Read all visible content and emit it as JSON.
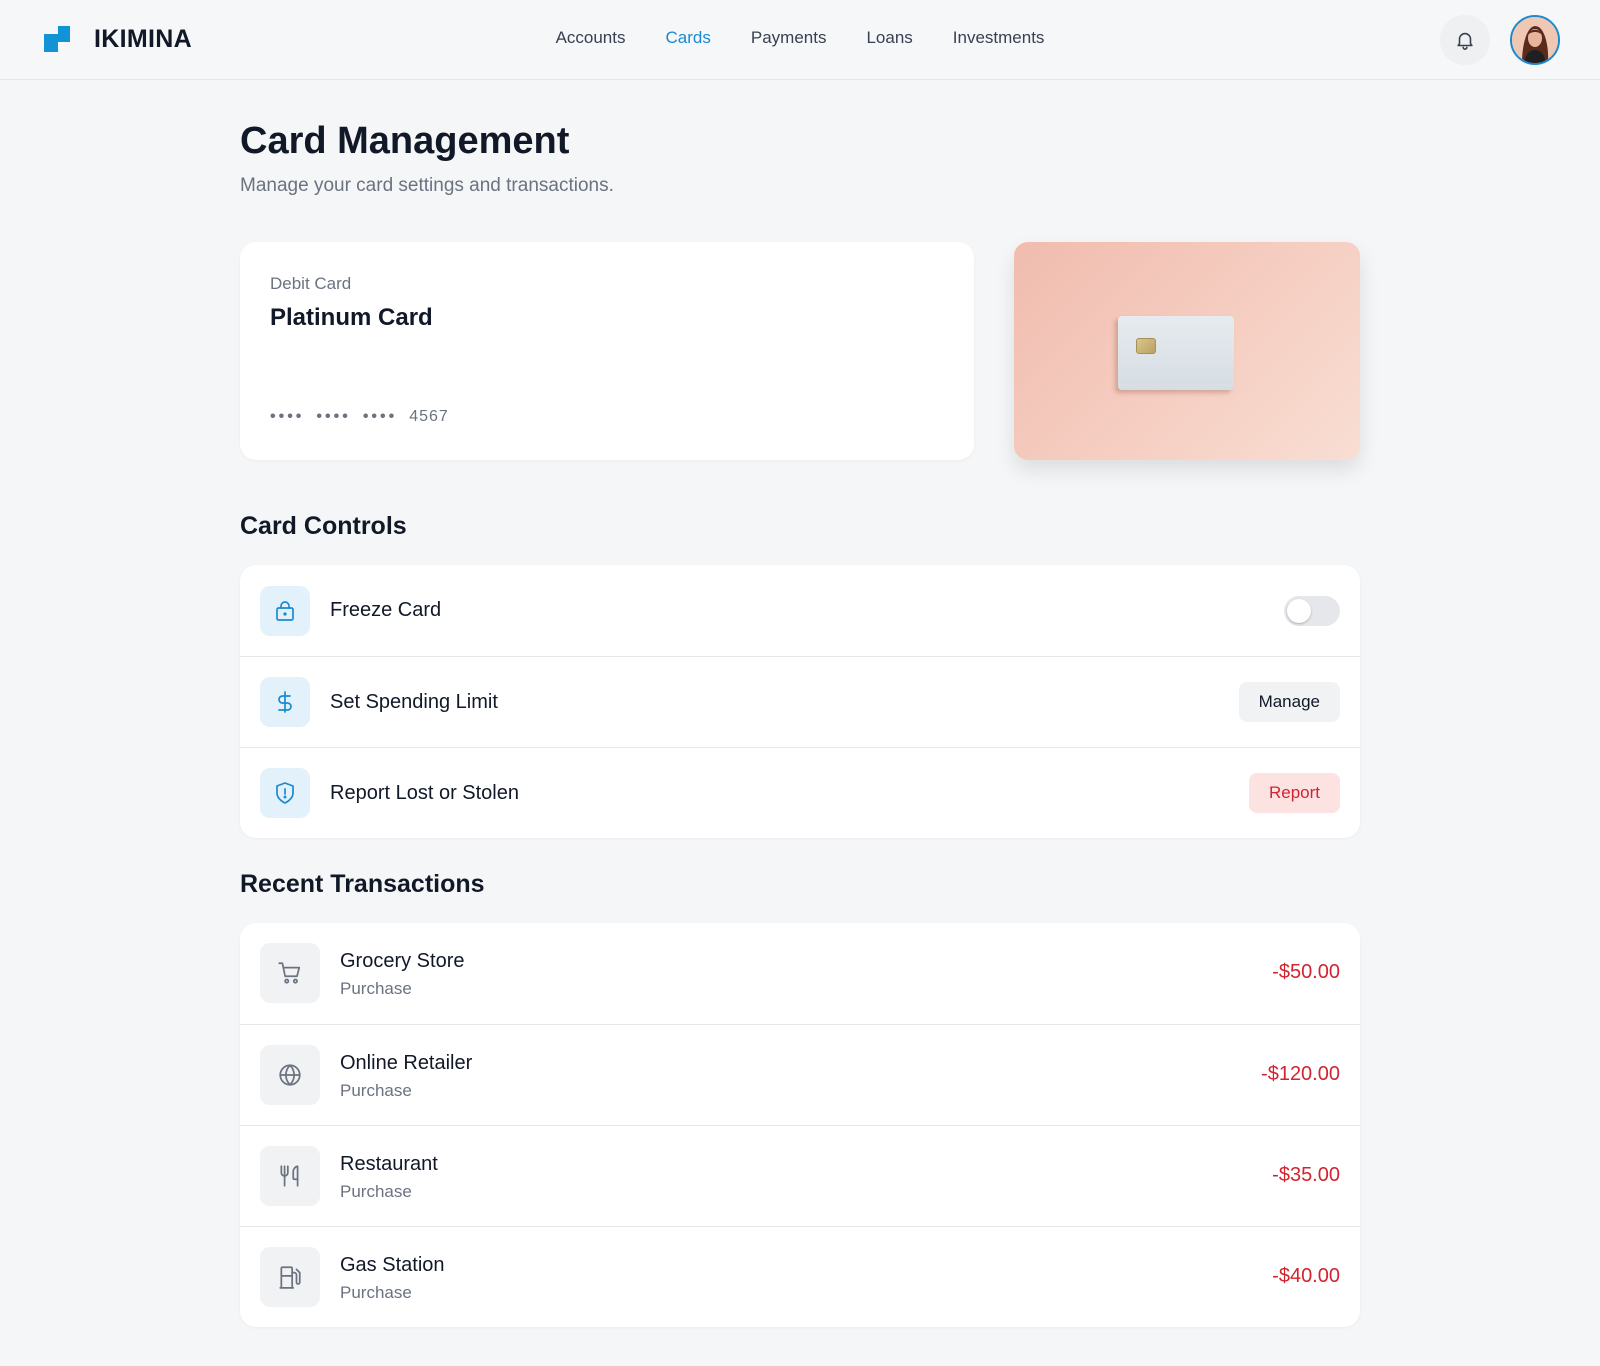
{
  "header": {
    "brand": "IKIMINA",
    "nav": [
      {
        "label": "Accounts",
        "active": false
      },
      {
        "label": "Cards",
        "active": true
      },
      {
        "label": "Payments",
        "active": false
      },
      {
        "label": "Loans",
        "active": false
      },
      {
        "label": "Investments",
        "active": false
      }
    ],
    "notification_icon": "bell-icon",
    "avatar_icon": "user-avatar"
  },
  "page": {
    "title": "Card Management",
    "subtitle": "Manage your card settings and transactions."
  },
  "card": {
    "type": "Debit Card",
    "name": "Platinum Card",
    "masked_groups": [
      "••••",
      "••••",
      "••••"
    ],
    "last4": "4567"
  },
  "controls": {
    "title": "Card Controls",
    "items": [
      {
        "label": "Freeze Card",
        "icon": "lock-icon",
        "action": "toggle",
        "toggle_on": false
      },
      {
        "label": "Set Spending Limit",
        "icon": "dollar-icon",
        "action": "Manage"
      },
      {
        "label": "Report Lost or Stolen",
        "icon": "shield-alert-icon",
        "action": "Report"
      }
    ]
  },
  "transactions": {
    "title": "Recent Transactions",
    "items": [
      {
        "name": "Grocery Store",
        "type": "Purchase",
        "amount": "-$50.00",
        "icon": "cart-icon"
      },
      {
        "name": "Online Retailer",
        "type": "Purchase",
        "amount": "-$120.00",
        "icon": "globe-icon"
      },
      {
        "name": "Restaurant",
        "type": "Purchase",
        "amount": "-$35.00",
        "icon": "utensils-icon"
      },
      {
        "name": "Gas Station",
        "type": "Purchase",
        "amount": "-$40.00",
        "icon": "fuel-icon"
      }
    ]
  },
  "colors": {
    "accent": "#1a8ad0",
    "danger": "#d1242f",
    "card_gradient_start": "#f0bcae",
    "card_gradient_end": "#f9ded3"
  }
}
